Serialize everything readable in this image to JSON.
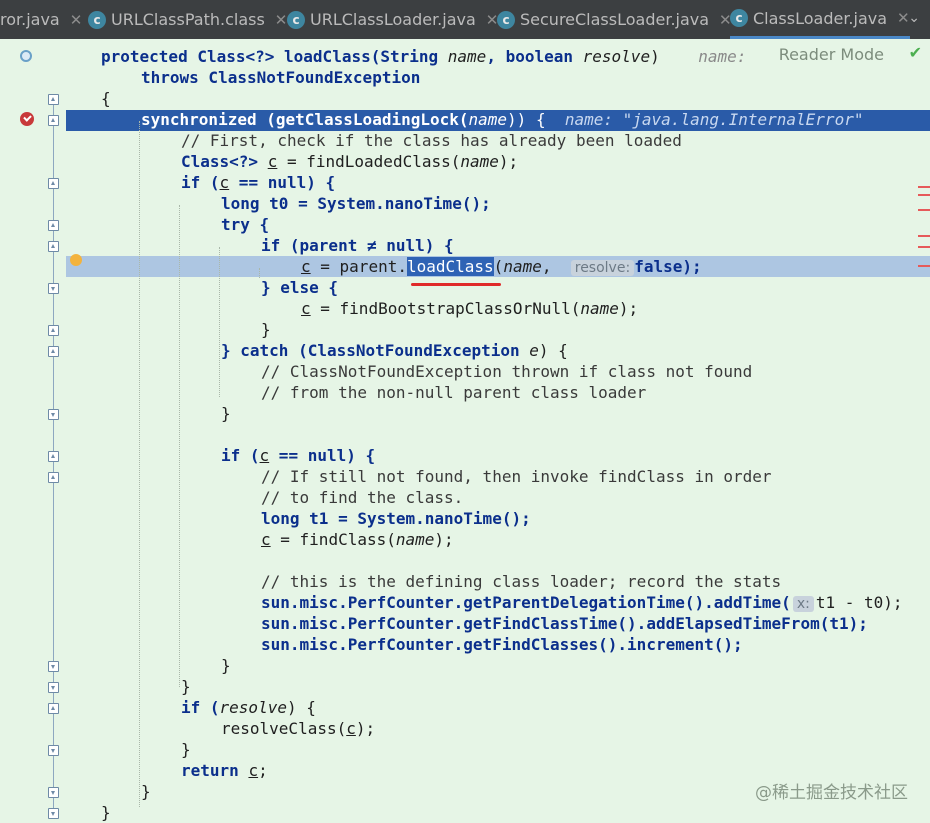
{
  "tabs": [
    {
      "label": "ror.java",
      "has_icon": false,
      "active": false
    },
    {
      "label": "URLClassPath.class",
      "has_icon": true,
      "active": false
    },
    {
      "label": "URLClassLoader.java",
      "has_icon": true,
      "active": false
    },
    {
      "label": "SecureClassLoader.java",
      "has_icon": true,
      "active": false
    },
    {
      "label": "ClassLoader.java",
      "has_icon": true,
      "active": true
    }
  ],
  "editor": {
    "reader_mode": "Reader Mode",
    "debug_name_label": "name:",
    "debug_inline_value": "name: \"java.lang.InternalError\"",
    "param_hint_resolve": "resolve:",
    "param_hint_x": "x:"
  },
  "code": {
    "l1_a": "protected Class<?> loadClass(String ",
    "l1_b": "name",
    "l1_c": ", boolean ",
    "l1_d": "resolve",
    "l1_e": ")",
    "l2": "throws ClassNotFoundException",
    "l3": "{",
    "l4_a": "synchronized (getClassLoadingLock(",
    "l4_b": "name",
    "l4_c": ")) {",
    "l5": "// First, check if the class has already been loaded",
    "l6_a": "Class<?> ",
    "l6_b": "c",
    "l6_c": " = findLoadedClass(",
    "l6_d": "name",
    "l6_e": ");",
    "l7_a": "if (",
    "l7_b": "c",
    "l7_c": " == null) {",
    "l8": "long t0 = System.nanoTime();",
    "l9": "try {",
    "l10": "if (parent ≠ null) {",
    "l11_a": "c",
    "l11_b": " = parent.",
    "l11_c": "loadClass",
    "l11_d": "(",
    "l11_e": "name",
    "l11_f": ", ",
    "l11_g": "false);",
    "l12": "} else {",
    "l13_a": "c",
    "l13_b": " = findBootstrapClassOrNull(",
    "l13_c": "name",
    "l13_d": ");",
    "l14": "}",
    "l15_a": "} catch (ClassNotFoundException ",
    "l15_b": "e",
    "l15_c": ") {",
    "l16": "// ClassNotFoundException thrown if class not found",
    "l17": "// from the non-null parent class loader",
    "l18": "}",
    "l20_a": "if (",
    "l20_b": "c",
    "l20_c": " == null) {",
    "l21": "// If still not found, then invoke findClass in order",
    "l22": "// to find the class.",
    "l23": "long t1 = System.nanoTime();",
    "l24_a": "c",
    "l24_b": " = findClass(",
    "l24_c": "name",
    "l24_d": ");",
    "l26": "// this is the defining class loader; record the stats",
    "l27_a": "sun.misc.PerfCounter.getParentDelegationTime().addTime(",
    "l27_b": "t1 - t0);",
    "l28": "sun.misc.PerfCounter.getFindClassTime().addElapsedTimeFrom(t1);",
    "l29": "sun.misc.PerfCounter.getFindClasses().increment();",
    "l30": "}",
    "l31": "}",
    "l32_a": "if (",
    "l32_b": "resolve",
    "l32_c": ") {",
    "l33_a": "resolveClass(",
    "l33_b": "c",
    "l33_c": ");",
    "l34": "}",
    "l35_a": "return ",
    "l35_b": "c",
    "l35_c": ";",
    "l36": "}",
    "l37": "}"
  },
  "watermark": "@稀土掘金技术社区"
}
